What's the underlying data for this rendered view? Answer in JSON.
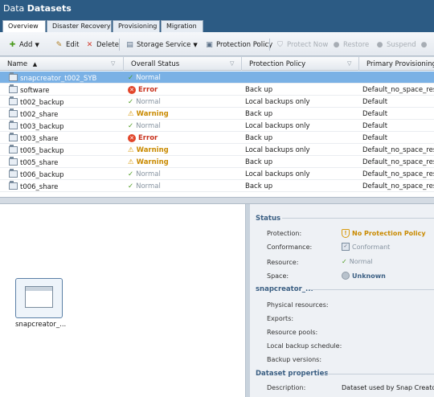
{
  "title": {
    "prefix": "Data",
    "main": "Datasets"
  },
  "tabs": [
    "Overview",
    "Disaster Recovery",
    "Provisioning",
    "Migration"
  ],
  "toolbar": {
    "add": "Add",
    "edit": "Edit",
    "delete": "Delete",
    "storage_service": "Storage Service",
    "protection_policy": "Protection Policy",
    "protect_now": "Protect Now",
    "restore": "Restore",
    "suspend": "Suspend"
  },
  "grid": {
    "columns": [
      "Name",
      "Overall Status",
      "Protection Policy",
      "Primary Provisioning Polic"
    ],
    "rows": [
      {
        "name": "snapcreator_t002_SYB",
        "status": "Normal",
        "policy": "",
        "prov": "",
        "selected": true
      },
      {
        "name": "software",
        "status": "Error",
        "policy": "Back up",
        "prov": "Default_no_space_reser"
      },
      {
        "name": "t002_backup",
        "status": "Normal",
        "policy": "Local backups only",
        "prov": "Default"
      },
      {
        "name": "t002_share",
        "status": "Warning",
        "policy": "Back up",
        "prov": "Default"
      },
      {
        "name": "t003_backup",
        "status": "Normal",
        "policy": "Local backups only",
        "prov": "Default"
      },
      {
        "name": "t003_share",
        "status": "Error",
        "policy": "Back up",
        "prov": "Default"
      },
      {
        "name": "t005_backup",
        "status": "Warning",
        "policy": "Local backups only",
        "prov": "Default_no_space_reser"
      },
      {
        "name": "t005_share",
        "status": "Warning",
        "policy": "Back up",
        "prov": "Default_no_space_reser"
      },
      {
        "name": "t006_backup",
        "status": "Normal",
        "policy": "Local backups only",
        "prov": "Default_no_space_reser"
      },
      {
        "name": "t006_share",
        "status": "Normal",
        "policy": "Back up",
        "prov": "Default_no_space_reser"
      }
    ]
  },
  "left": {
    "tile_label": "snapcreator_..."
  },
  "details": {
    "status_title": "Status",
    "protection_label": "Protection:",
    "protection_value": "No Protection Policy",
    "conformance_label": "Conformance:",
    "conformance_value": "Conformant",
    "resource_label": "Resource:",
    "resource_value": "Normal",
    "space_label": "Space:",
    "space_value": "Unknown",
    "group_title": "snapcreator_...",
    "physical_label": "Physical resources:",
    "exports_label": "Exports:",
    "pools_label": "Resource pools:",
    "schedule_label": "Local backup schedule:",
    "versions_label": "Backup versions:",
    "props_title": "Dataset properties",
    "description_label": "Description:",
    "description_value": "Dataset used by Snap Creator F"
  }
}
